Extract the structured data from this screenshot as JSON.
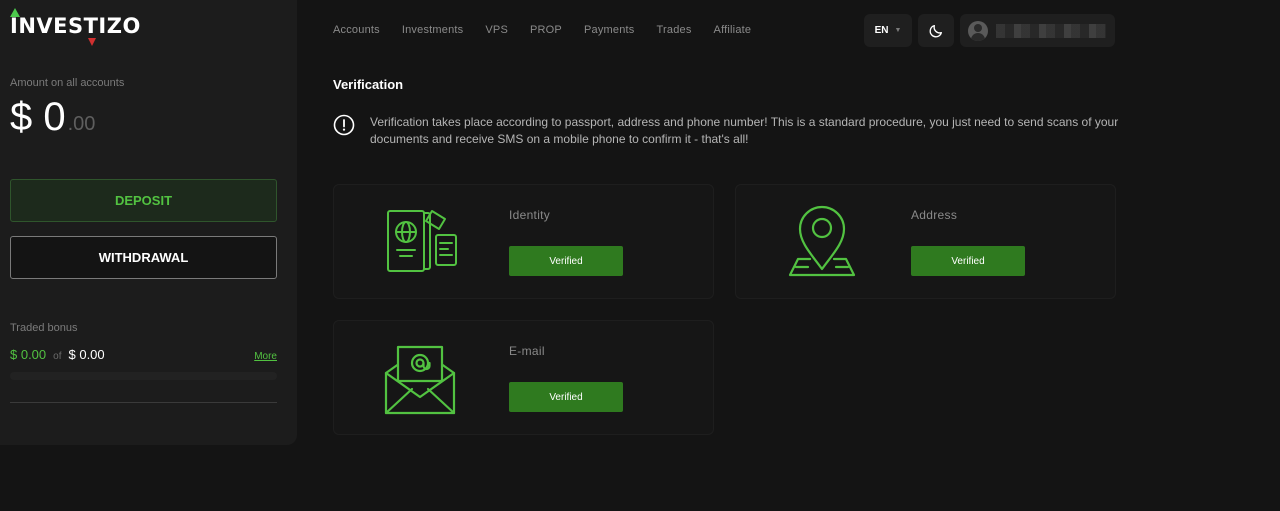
{
  "brand": {
    "name": "INVESTIZO",
    "accent": "#52c241"
  },
  "sidebar": {
    "balance_label": "Amount on all accounts",
    "balance_main": "$ 0",
    "balance_cents": ".00",
    "deposit_label": "DEPOSIT",
    "withdraw_label": "WITHDRAWAL",
    "bonus_label": "Traded bonus",
    "bonus_value": "$ 0.00",
    "bonus_of": "of",
    "bonus_total": "$ 0.00",
    "bonus_more": "More",
    "bonus_progress": 0
  },
  "nav": {
    "items": [
      "Accounts",
      "Investments",
      "VPS",
      "PROP",
      "Payments",
      "Trades",
      "Affiliate"
    ]
  },
  "header": {
    "language": "EN",
    "theme_icon": "moon-icon",
    "user_icon": "avatar-icon"
  },
  "main": {
    "title": "Verification",
    "notice_icon": "info-icon",
    "notice": "Verification takes place according to passport, address and phone number! This is a standard procedure, you just need to send scans of your documents and receive SMS on a mobile phone to confirm it - that's all!",
    "cards": [
      {
        "title": "Identity",
        "status": "Verified",
        "icon": "passport-icon"
      },
      {
        "title": "Address",
        "status": "Verified",
        "icon": "map-pin-icon"
      },
      {
        "title": "E-mail",
        "status": "Verified",
        "icon": "envelope-icon"
      }
    ]
  }
}
